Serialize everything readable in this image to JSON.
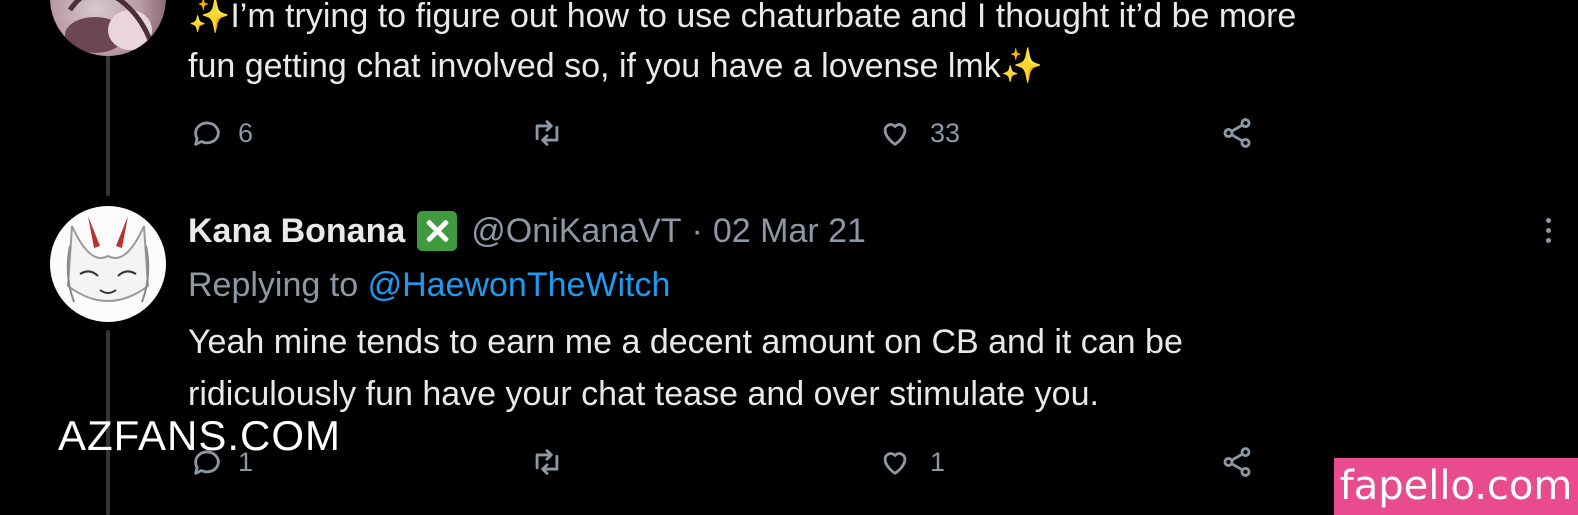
{
  "thread": {
    "top_tweet": {
      "text_line1_sparkle": "✨",
      "text_line1": "I’m trying to figure out how to use chaturbate and I thought it’d be more",
      "text_line2": "fun getting chat involved so, if you have a lovense lmk",
      "text_line2_sparkle": "✨",
      "actions": {
        "reply_count": "6",
        "retweet_count": "",
        "like_count": "33"
      }
    },
    "reply_tweet": {
      "display_name": "Kana Bonana",
      "handle": "@OniKanaVT",
      "separator": "·",
      "date": "02 Mar 21",
      "replying_to_prefix": "Replying to",
      "replying_to_handle": "@HaewonTheWitch",
      "text_line1": "Yeah mine tends to earn me a decent amount on CB and it can be",
      "text_line2": "ridiculously fun have your chat tease and over stimulate you.",
      "actions": {
        "reply_count": "1",
        "retweet_count": "",
        "like_count": "1"
      }
    }
  },
  "icons": {
    "reply": "reply-icon",
    "retweet": "retweet-icon",
    "like": "heart-icon",
    "share": "share-icon",
    "more": "more-icon",
    "verified": "cross-mark-icon"
  },
  "watermarks": {
    "left": "AZFANS.COM",
    "right": "fapello.com"
  },
  "colors": {
    "background": "#000000",
    "text": "#e7e9ea",
    "secondary": "#8b98a5",
    "mention": "#1d9bf0",
    "verified_badge": "#3f9a3f",
    "fapello_badge": "#e84c8e"
  }
}
